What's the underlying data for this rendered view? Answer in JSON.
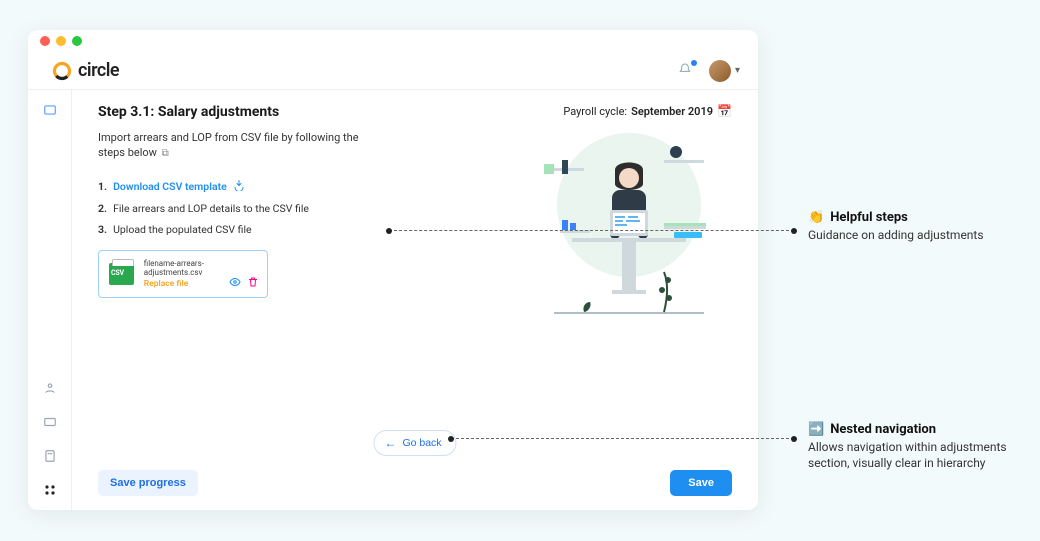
{
  "brand": "circle",
  "header": {
    "step_title": "Step 3.1: Salary adjustments",
    "payroll_label": "Payroll cycle:",
    "payroll_value": "September 2019"
  },
  "subtext": "Import arrears and LOP from CSV file by following the steps below",
  "steps": {
    "s1_num": "1.",
    "s1_text": "Download CSV template",
    "s2_num": "2.",
    "s2_text": "File arrears and LOP details to the CSV file",
    "s3_num": "3.",
    "s3_text": "Upload the populated CSV file"
  },
  "file": {
    "name": "filename-arrears-adjustments.csv",
    "replace": "Replace file"
  },
  "goback": "Go back",
  "footer": {
    "save_progress": "Save progress",
    "save": "Save"
  },
  "annotations": {
    "a1_emoji": "👏",
    "a1_title": "Helpful steps",
    "a1_desc": "Guidance on adding adjustments",
    "a2_emoji": "➡️",
    "a2_title": "Nested navigation",
    "a2_desc": "Allows navigation within adjustments section, visually clear in hierarchy"
  }
}
